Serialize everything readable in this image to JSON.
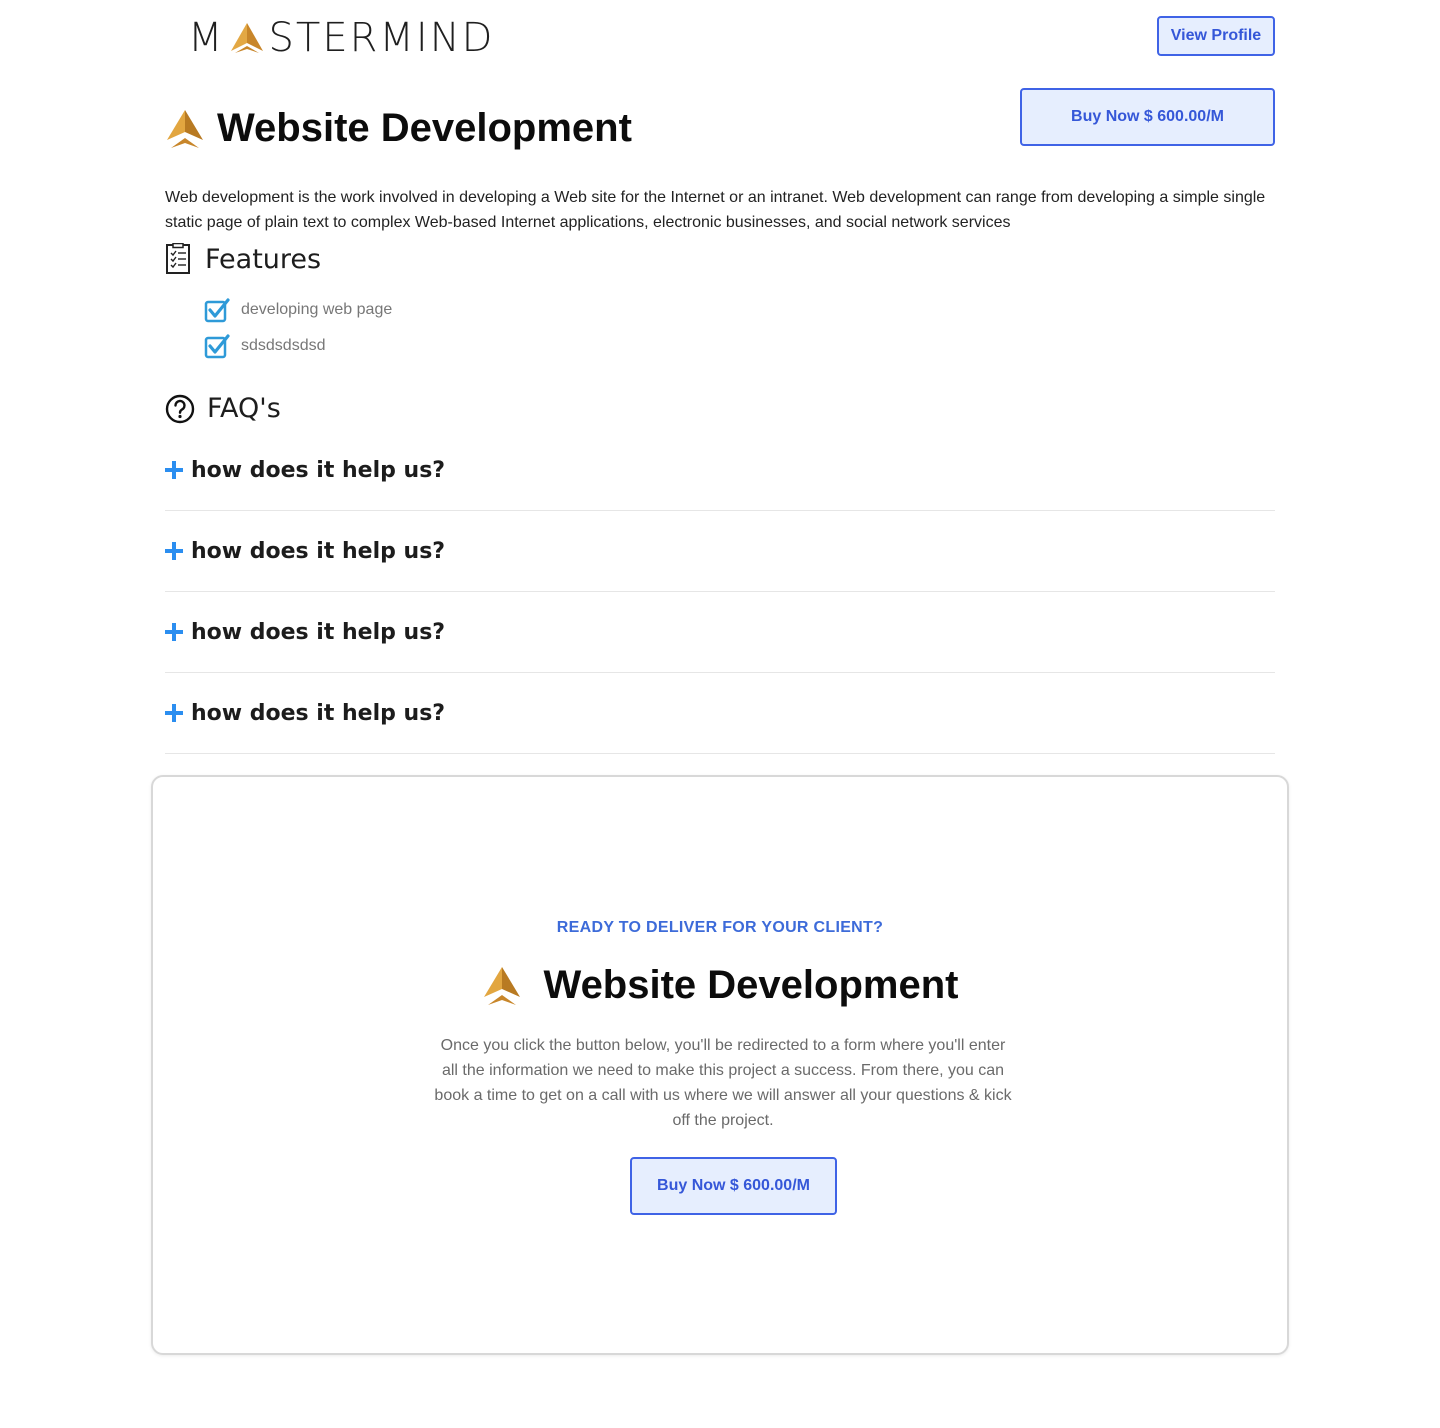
{
  "header": {
    "logo_text_left": "M",
    "logo_text_right": "STERMIND",
    "view_profile_label": "View Profile"
  },
  "service": {
    "title": "Website Development",
    "buy_label": "Buy Now $ 600.00/M",
    "description": "Web development is the work involved in developing a Web site for the Internet or an intranet. Web development can range from developing a simple single static page of plain text to complex Web-based Internet applications, electronic businesses, and social network services"
  },
  "features": {
    "heading": "Features",
    "items": [
      {
        "label": "developing web page"
      },
      {
        "label": "sdsdsdsdsd"
      }
    ]
  },
  "faq": {
    "heading": "FAQ's",
    "items": [
      {
        "question": "how does it help us?"
      },
      {
        "question": "how does it help us?"
      },
      {
        "question": "how does it help us?"
      },
      {
        "question": "how does it help us?"
      }
    ]
  },
  "cta": {
    "eyebrow": "READY TO DELIVER FOR YOUR CLIENT?",
    "title": "Website Development",
    "text": "Once you click the button below, you'll be redirected to a form where you'll enter all the information we need to make this project a success. From there, you can book a time to get on a call with us where we will answer all your questions & kick off the project.",
    "buy_label": "Buy Now $ 600.00/M"
  },
  "colors": {
    "accent": "#3f63e6",
    "accent_text": "#3557d8",
    "button_bg": "#e6eefe",
    "plus_blue": "#2b8ef0",
    "brand_gold": "#c8862a"
  },
  "icons": {
    "brand": "mastermind-arrow-icon",
    "features": "checklist-icon",
    "feature_item": "checkbox-checked-icon",
    "faq": "question-circle-icon",
    "faq_item": "plus-icon"
  }
}
